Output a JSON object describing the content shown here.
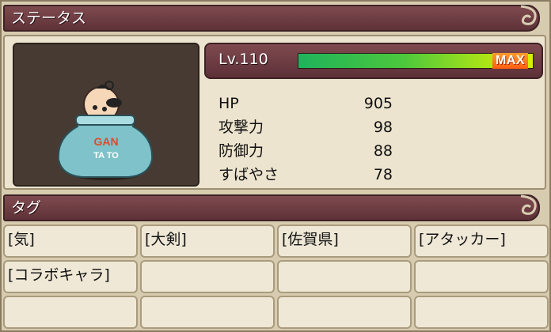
{
  "status_header": {
    "title": "ステータス"
  },
  "level": {
    "label": "Lv.110",
    "max_label": "MAX",
    "exp_fraction": 1.0
  },
  "stats": [
    {
      "name": "HP",
      "value": "905"
    },
    {
      "name": "攻撃力",
      "value": "98"
    },
    {
      "name": "防御力",
      "value": "88"
    },
    {
      "name": "すばやさ",
      "value": "78"
    }
  ],
  "portrait": {
    "jar_text_line1": "GAN",
    "jar_text_line2": "TA TO",
    "icon": "character-in-jar"
  },
  "tag_header": {
    "title": "タグ"
  },
  "tags": [
    "[気]",
    "[大剣]",
    "[佐賀県]",
    "[アタッカー]",
    "[コラボキャラ]",
    "",
    "",
    "",
    "",
    "",
    "",
    ""
  ],
  "colors": {
    "header": "#6e3c43",
    "panel": "#ede4cf",
    "exp_start": "#1fb35c",
    "exp_end": "#d7f100",
    "max_badge": "#ff6a18"
  }
}
